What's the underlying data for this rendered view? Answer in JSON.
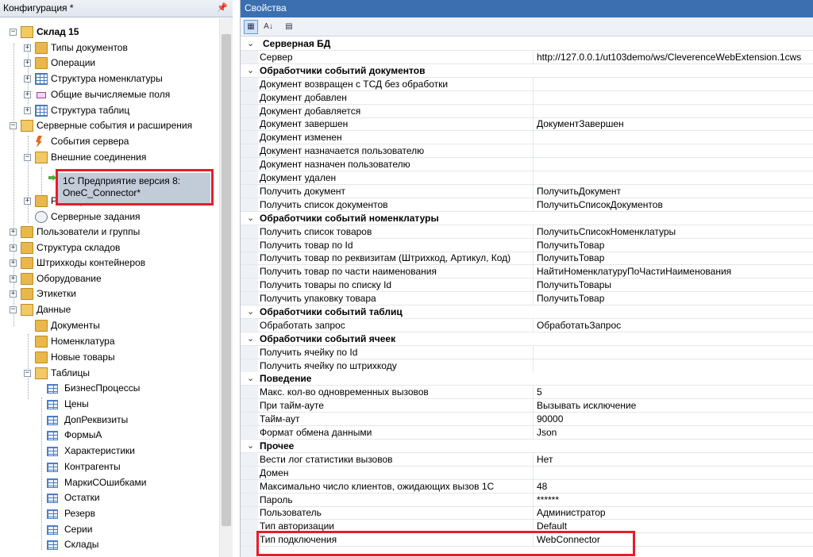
{
  "left_panel": {
    "title": "Конфигурация *",
    "pin_icon": "pin-icon",
    "tree": [
      {
        "label": "Склад 15",
        "bold": true,
        "level": 0
      },
      {
        "label": "Типы документов",
        "level": 1
      },
      {
        "label": "Операции",
        "level": 1
      },
      {
        "label": "Структура номенклатуры",
        "level": 1
      },
      {
        "label": "Общие вычисляемые поля",
        "level": 1
      },
      {
        "label": "Структура таблиц",
        "level": 1
      },
      {
        "label": "Серверные события и расширения",
        "level": 0
      },
      {
        "label": "События сервера",
        "level": 1
      },
      {
        "label": "Внешние соединения",
        "level": 1
      },
      {
        "label": "1С Предприятие версия 8: OneC_Connector*",
        "level": 2
      },
      {
        "label": "Расширения",
        "level": 1
      },
      {
        "label": "Серверные задания",
        "level": 1
      },
      {
        "label": "Пользователи и группы",
        "level": 0
      },
      {
        "label": "Структура складов",
        "level": 0
      },
      {
        "label": "Штрихкоды контейнеров",
        "level": 0
      },
      {
        "label": "Оборудование",
        "level": 0
      },
      {
        "label": "Этикетки",
        "level": 0
      },
      {
        "label": "Данные",
        "level": 0
      },
      {
        "label": "Документы",
        "level": 1
      },
      {
        "label": "Номенклатура",
        "level": 1
      },
      {
        "label": "Новые товары",
        "level": 1
      },
      {
        "label": "Таблицы",
        "level": 1
      },
      {
        "label": "БизнесПроцессы",
        "level": 2
      },
      {
        "label": "Цены",
        "level": 2
      },
      {
        "label": "ДопРеквизиты",
        "level": 2
      },
      {
        "label": "ФормыА",
        "level": 2
      },
      {
        "label": "Характеристики",
        "level": 2
      },
      {
        "label": "Контрагенты",
        "level": 2
      },
      {
        "label": "МаркиСОшибками",
        "level": 2
      },
      {
        "label": "Остатки",
        "level": 2
      },
      {
        "label": "Резерв",
        "level": 2
      },
      {
        "label": "Серии",
        "level": 2
      },
      {
        "label": "Склады",
        "level": 2
      }
    ],
    "selected_line1": "1С Предприятие версия 8:",
    "selected_line2": "OneC_Connector*"
  },
  "right_panel": {
    "title": "Свойства",
    "toolbar": [
      "categorized-icon",
      "alphabetical-icon",
      "property-pages-icon"
    ],
    "sections": [
      {
        "title": "Серверная БД",
        "rows": [
          {
            "name": "Сервер",
            "value": "http://127.0.0.1/ut103demo/ws/CleverenceWebExtension.1cws"
          }
        ]
      },
      {
        "title": "Обработчики событий документов",
        "rows": [
          {
            "name": "Документ возвращен с ТСД без обработки",
            "value": ""
          },
          {
            "name": "Документ добавлен",
            "value": ""
          },
          {
            "name": "Документ добавляется",
            "value": ""
          },
          {
            "name": "Документ завершен",
            "value": "ДокументЗавершен"
          },
          {
            "name": "Документ изменен",
            "value": ""
          },
          {
            "name": "Документ назначается пользователю",
            "value": ""
          },
          {
            "name": "Документ назначен пользователю",
            "value": ""
          },
          {
            "name": "Документ удален",
            "value": ""
          },
          {
            "name": "Получить документ",
            "value": "ПолучитьДокумент"
          },
          {
            "name": "Получить список документов",
            "value": "ПолучитьСписокДокументов"
          }
        ]
      },
      {
        "title": "Обработчики событий номенклатуры",
        "rows": [
          {
            "name": "Получить список товаров",
            "value": "ПолучитьСписокНоменклатуры"
          },
          {
            "name": "Получить товар по Id",
            "value": "ПолучитьТовар"
          },
          {
            "name": "Получить товар по реквизитам (Штрихкод, Артикул, Код)",
            "value": "ПолучитьТовар"
          },
          {
            "name": "Получить товар по части наименования",
            "value": "НайтиНоменклатуруПоЧастиНаименования"
          },
          {
            "name": "Получить товары по списку Id",
            "value": "ПолучитьТовары"
          },
          {
            "name": "Получить упаковку товара",
            "value": "ПолучитьТовар"
          }
        ]
      },
      {
        "title": "Обработчики событий таблиц",
        "rows": [
          {
            "name": "Обработать запрос",
            "value": "ОбработатьЗапрос"
          }
        ]
      },
      {
        "title": "Обработчики событий ячеек",
        "rows": [
          {
            "name": "Получить ячейку по Id",
            "value": ""
          },
          {
            "name": "Получить ячейку по штрихкоду",
            "value": ""
          }
        ]
      },
      {
        "title": "Поведение",
        "rows": [
          {
            "name": "Макс. кол-во одновременных вызовов",
            "value": "5"
          },
          {
            "name": "При тайм-ауте",
            "value": "Вызывать исключение"
          },
          {
            "name": "Тайм-аут",
            "value": "90000"
          },
          {
            "name": "Формат обмена данными",
            "value": "Json"
          }
        ]
      },
      {
        "title": "Прочее",
        "rows": [
          {
            "name": "Вести лог статистики вызовов",
            "value": "Нет"
          },
          {
            "name": "Домен",
            "value": ""
          },
          {
            "name": "Максимально число клиентов, ожидающих вызов 1С",
            "value": "48"
          },
          {
            "name": "Пароль",
            "value": "******"
          },
          {
            "name": "Пользователь",
            "value": "Администратор"
          },
          {
            "name": "Тип авторизации",
            "value": "Default"
          },
          {
            "name": "Тип подключения",
            "value": "WebConnector"
          }
        ]
      }
    ]
  },
  "colors": {
    "highlight": "#e41e2b",
    "header_blue": "#3b6fb0",
    "selection": "#c2cbd8"
  }
}
